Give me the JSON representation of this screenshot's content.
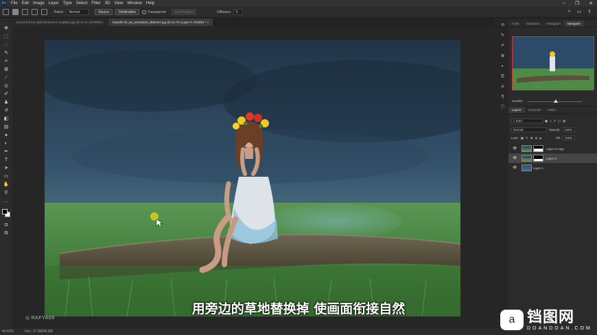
{
  "menubar": {
    "app_logo": "Ps",
    "items": [
      "File",
      "Edit",
      "Image",
      "Layer",
      "Type",
      "Select",
      "Filter",
      "3D",
      "View",
      "Window",
      "Help"
    ]
  },
  "options": {
    "patch_label": "Patch:",
    "patch_value": "Normal",
    "source_label": "Source",
    "destination_label": "Destination",
    "transparent_label": "Transparent",
    "use_pattern_label": "Use Pattern",
    "diffusion_label": "Diffusion:",
    "diffusion_value": "5"
  },
  "tabs": [
    {
      "label": "emma-francis-vpriil-bmeeOn1-unsplash.jpg @ 11.1% (RGB/8) ×"
    },
    {
      "label": "laeyalin-01_tw_ananda23_dloket47.jpg @ 44.7% (Layer 0, RGB/8) * ×"
    }
  ],
  "canvas": {
    "subtitle": "用旁边的草地替换掉 使画面衔接自然",
    "watermark": "RAFYA88"
  },
  "statusbar": {
    "zoom": "44.62%",
    "doc": "Doc: 17.0M/46.8M"
  },
  "navigator": {
    "tabs": [
      "Color",
      "Swatches",
      "Histogram",
      "Navigator"
    ],
    "active_tab": "Navigator",
    "zoom": "44.62%"
  },
  "layers_panel": {
    "tabs": [
      "Layers",
      "Channels",
      "Paths"
    ],
    "kind_label": "Kind",
    "blend_mode": "Normal",
    "opacity_label": "Opacity:",
    "opacity_value": "100%",
    "lock_label": "Lock:",
    "fill_label": "Fill:",
    "fill_value": "100%",
    "layers": [
      {
        "name": "Layer 0 copy",
        "selected": false
      },
      {
        "name": "Layer 0",
        "selected": true
      },
      {
        "name": "Layer 1",
        "selected": false
      }
    ]
  },
  "logo": {
    "main": "铛图网",
    "sub": "DOANDOAN.COM",
    "bubble_icon": "a"
  }
}
